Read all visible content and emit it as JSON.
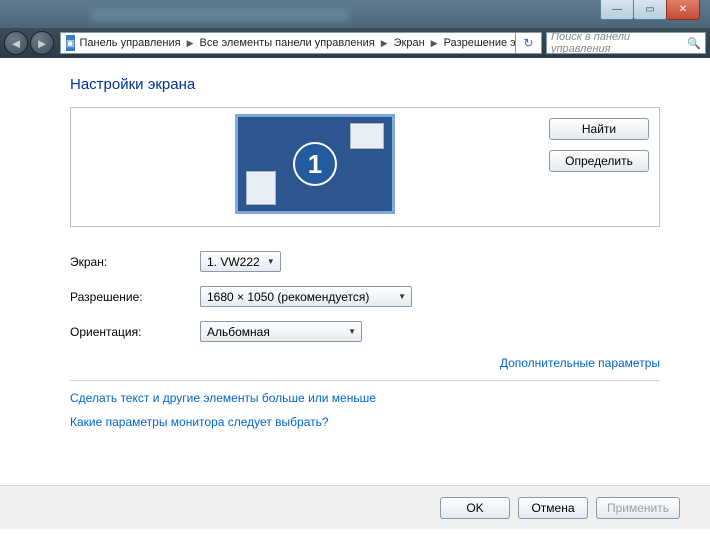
{
  "window": {
    "min": "—",
    "max": "▭",
    "close": "✕"
  },
  "nav": {
    "back": "◄",
    "forward": "►",
    "refresh": "↻"
  },
  "breadcrumb": {
    "items": [
      "Панель управления",
      "Все элементы панели управления",
      "Экран",
      "Разрешение экрана"
    ]
  },
  "search": {
    "placeholder": "Поиск в панели управления",
    "icon": "🔍"
  },
  "page": {
    "title": "Настройки экрана",
    "monitor_number": "1"
  },
  "buttons": {
    "find": "Найти",
    "identify": "Определить",
    "ok": "OK",
    "cancel": "Отмена",
    "apply": "Применить"
  },
  "form": {
    "screen_label": "Экран:",
    "screen_value": "1. VW222",
    "resolution_label": "Разрешение:",
    "resolution_value": "1680 × 1050 (рекомендуется)",
    "orientation_label": "Ориентация:",
    "orientation_value": "Альбомная"
  },
  "links": {
    "advanced": "Дополнительные параметры",
    "text_size": "Сделать текст и другие элементы больше или меньше",
    "which_monitor": "Какие параметры монитора следует выбрать?"
  }
}
